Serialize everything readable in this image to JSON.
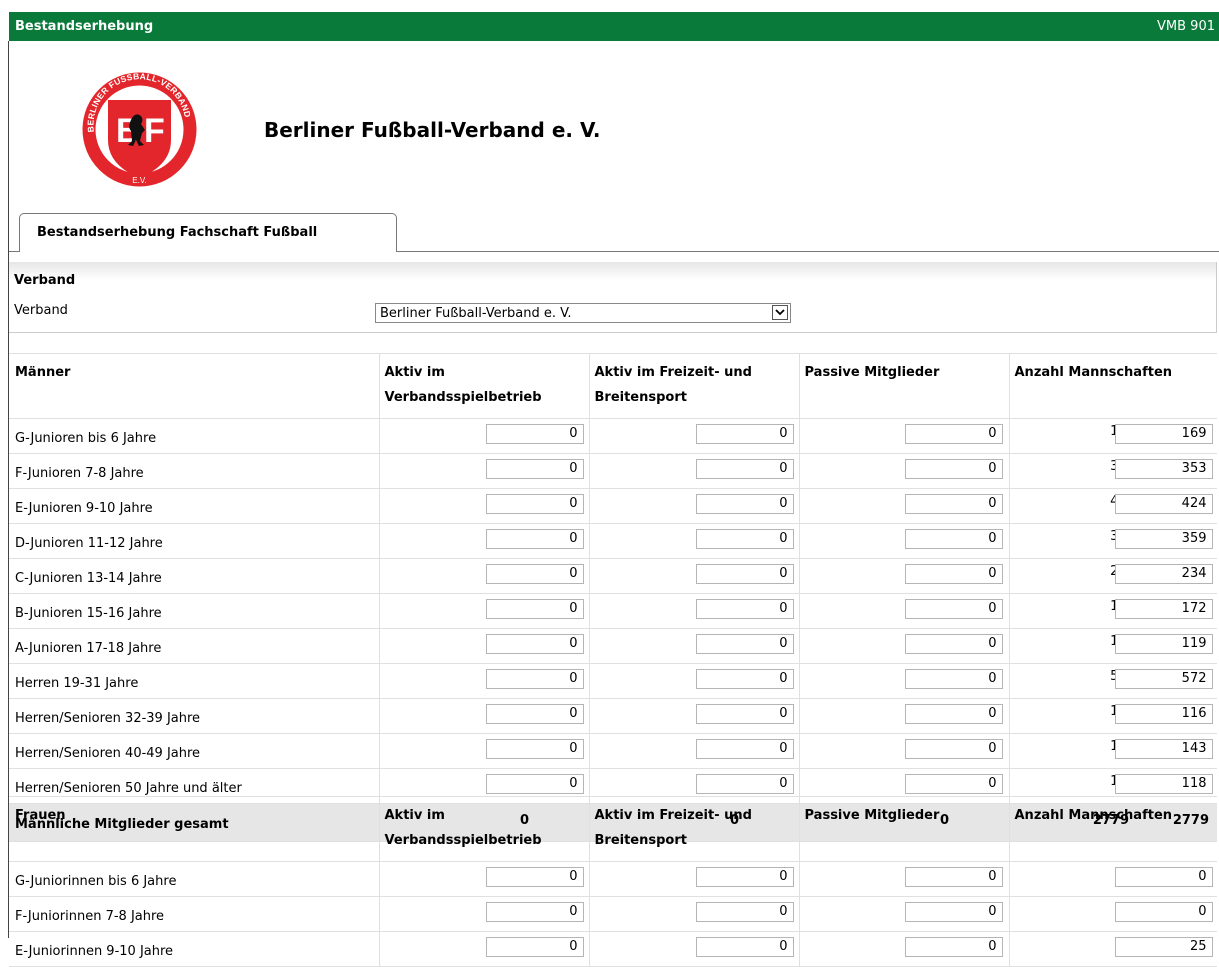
{
  "header": {
    "title": "Bestandserhebung",
    "code": "VMB 901"
  },
  "org": {
    "name": "Berliner Fußball-Verband e. V.",
    "logo_text_top": "BERLINER FUSSBALL-VERBAND",
    "logo_text_bottom": "E.V.",
    "logo_color": "#e3262b"
  },
  "tab": {
    "label": "Bestandserhebung Fachschaft Fußball"
  },
  "verband": {
    "section_title": "Verband",
    "field_label": "Verband",
    "selected": "Berliner Fußball-Verband e. V."
  },
  "columns": {
    "c1": "Aktiv im Verbandsspielbetrieb",
    "c1_l1": "Aktiv im",
    "c1_l2": "Verbandsspielbetrieb",
    "c2_l1": "Aktiv im Freizeit- und",
    "c2_l2": "Breitensport",
    "c3": "Passive Mitglieder",
    "c4": "Anzahl Mannschaften"
  },
  "maenner": {
    "title": "Männer",
    "rows": [
      {
        "label": "G-Junioren bis 6 Jahre",
        "a": "0",
        "b": "0",
        "c": "0",
        "fixed": "169",
        "d": "169"
      },
      {
        "label": "F-Junioren 7-8 Jahre",
        "a": "0",
        "b": "0",
        "c": "0",
        "fixed": "353",
        "d": "353"
      },
      {
        "label": "E-Junioren 9-10 Jahre",
        "a": "0",
        "b": "0",
        "c": "0",
        "fixed": "424",
        "d": "424"
      },
      {
        "label": "D-Junioren 11-12 Jahre",
        "a": "0",
        "b": "0",
        "c": "0",
        "fixed": "359",
        "d": "359"
      },
      {
        "label": "C-Junioren 13-14 Jahre",
        "a": "0",
        "b": "0",
        "c": "0",
        "fixed": "234",
        "d": "234"
      },
      {
        "label": "B-Junioren 15-16 Jahre",
        "a": "0",
        "b": "0",
        "c": "0",
        "fixed": "172",
        "d": "172"
      },
      {
        "label": "A-Junioren 17-18 Jahre",
        "a": "0",
        "b": "0",
        "c": "0",
        "fixed": "119",
        "d": "119"
      },
      {
        "label": "Herren 19-31 Jahre",
        "a": "0",
        "b": "0",
        "c": "0",
        "fixed": "572",
        "d": "572"
      },
      {
        "label": "Herren/Senioren 32-39 Jahre",
        "a": "0",
        "b": "0",
        "c": "0",
        "fixed": "116",
        "d": "116"
      },
      {
        "label": "Herren/Senioren 40-49 Jahre",
        "a": "0",
        "b": "0",
        "c": "0",
        "fixed": "143",
        "d": "143"
      },
      {
        "label": "Herren/Senioren 50 Jahre und älter",
        "a": "0",
        "b": "0",
        "c": "0",
        "fixed": "118",
        "d": "118"
      }
    ],
    "total": {
      "label": "Männliche Mitglieder gesamt",
      "values": [
        "0",
        "0",
        "0",
        "0",
        "0",
        "0",
        "2779",
        "2779"
      ]
    }
  },
  "frauen": {
    "title": "Frauen",
    "rows": [
      {
        "label": "G-Juniorinnen bis 6 Jahre",
        "a": "0",
        "b": "0",
        "c": "0",
        "fixed": "0",
        "d": "0"
      },
      {
        "label": "F-Juniorinnen 7-8 Jahre",
        "a": "0",
        "b": "0",
        "c": "0",
        "fixed": "0",
        "d": "0"
      },
      {
        "label": "E-Juniorinnen 9-10 Jahre",
        "a": "0",
        "b": "0",
        "c": "0",
        "fixed": "25",
        "d": "25"
      }
    ]
  }
}
